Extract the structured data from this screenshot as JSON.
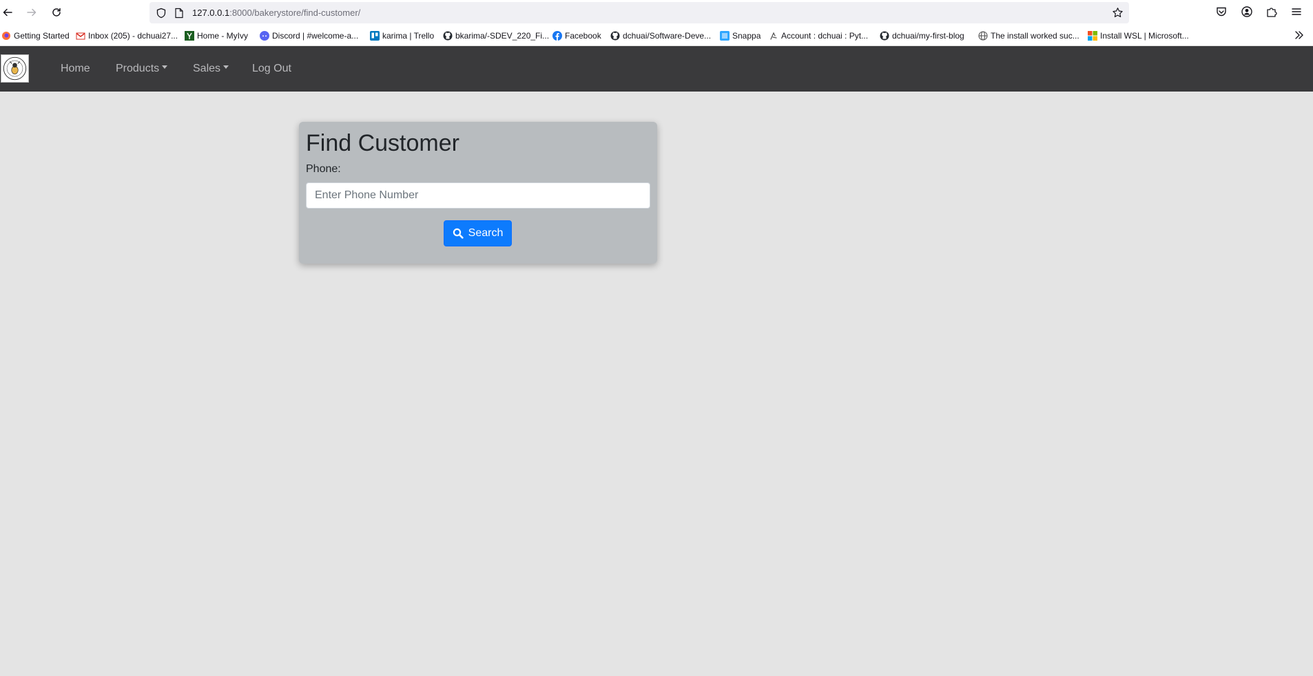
{
  "browser": {
    "url_host": "127.0.0.1",
    "url_path": ":8000/bakerystore/find-customer/"
  },
  "bookmarks": [
    {
      "label": "Getting Started",
      "icon": "firefox-icon",
      "color": "#ff7139"
    },
    {
      "label": "Inbox (205) - dchuai27...",
      "icon": "gmail-icon",
      "color": "#d93025"
    },
    {
      "label": "Home - MyIvy",
      "icon": "ivy-icon",
      "color": "#1b5e20"
    },
    {
      "label": "Discord | #welcome-a...",
      "icon": "discord-icon",
      "color": "#5865f2"
    },
    {
      "label": "karima | Trello",
      "icon": "trello-icon",
      "color": "#0079bf"
    },
    {
      "label": "bkarima/-SDEV_220_Fi...",
      "icon": "github-icon",
      "color": "#24292f"
    },
    {
      "label": "Facebook",
      "icon": "facebook-icon",
      "color": "#1877f2"
    },
    {
      "label": "dchuai/Software-Deve...",
      "icon": "github-icon",
      "color": "#24292f"
    },
    {
      "label": "Snappa",
      "icon": "snappa-icon",
      "color": "#2ea6ff"
    },
    {
      "label": "Account : dchuai : Pyt...",
      "icon": "python-icon",
      "color": "#555555"
    },
    {
      "label": "dchuai/my-first-blog",
      "icon": "github-icon",
      "color": "#24292f"
    },
    {
      "label": "The install worked suc...",
      "icon": "globe-icon",
      "color": "#555555"
    },
    {
      "label": "Install WSL | Microsoft...",
      "icon": "microsoft-icon",
      "color": "#f25022"
    }
  ],
  "navbar": {
    "items": [
      {
        "label": "Home",
        "dropdown": false
      },
      {
        "label": "Products",
        "dropdown": true
      },
      {
        "label": "Sales",
        "dropdown": true
      },
      {
        "label": "Log Out",
        "dropdown": false
      }
    ]
  },
  "find_customer": {
    "title": "Find Customer",
    "phone_label": "Phone:",
    "phone_placeholder": "Enter Phone Number",
    "phone_value": "",
    "search_label": "Search"
  },
  "colors": {
    "page_bg": "#e4e4e4",
    "navbar_bg": "#3a3a3c",
    "card_bg": "#b8bcbf",
    "primary": "#0d7bfd"
  }
}
